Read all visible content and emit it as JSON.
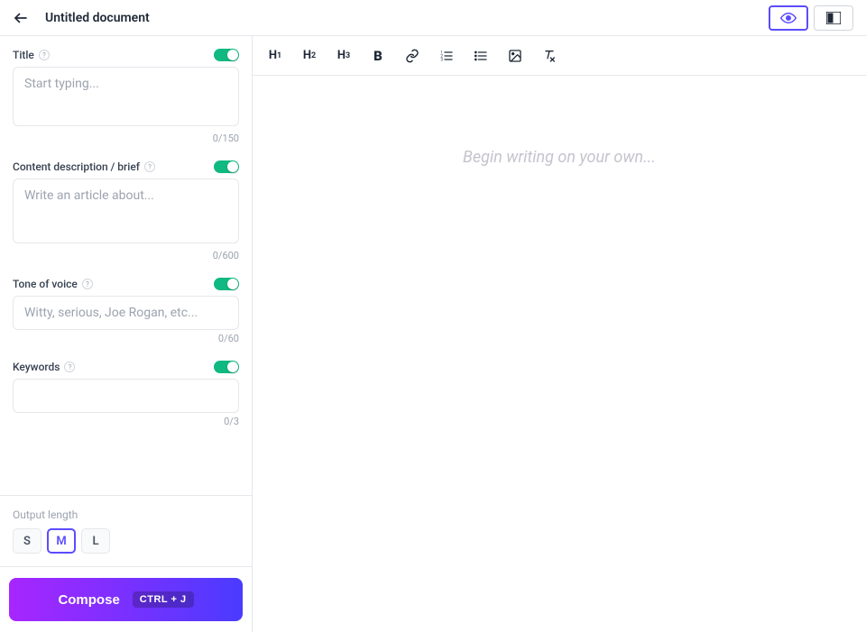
{
  "header": {
    "doc_title": "Untitled document"
  },
  "sidebar": {
    "title": {
      "label": "Title",
      "placeholder": "Start typing...",
      "counter": "0/150"
    },
    "content": {
      "label": "Content description / brief",
      "placeholder": "Write an article about...",
      "counter": "0/600"
    },
    "tone": {
      "label": "Tone of voice",
      "placeholder": "Witty, serious, Joe Rogan, etc...",
      "counter": "0/60"
    },
    "keywords": {
      "label": "Keywords",
      "counter": "0/3"
    },
    "output": {
      "label": "Output length",
      "options": [
        "S",
        "M",
        "L"
      ],
      "selected": "M"
    },
    "compose": {
      "label": "Compose",
      "shortcut": "CTRL + J"
    }
  },
  "editor": {
    "placeholder": "Begin writing on your own..."
  }
}
